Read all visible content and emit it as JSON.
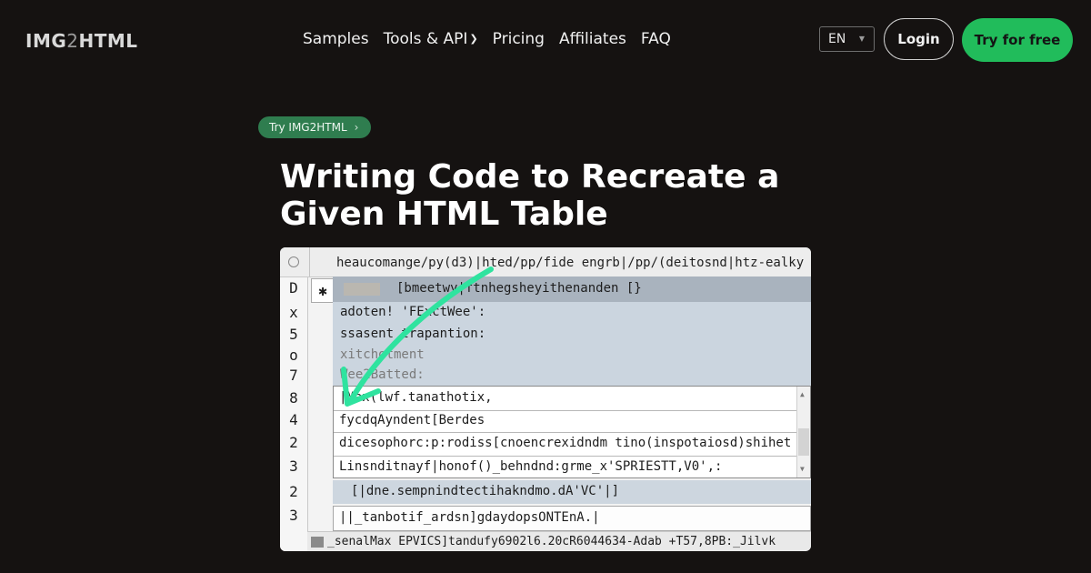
{
  "brand": {
    "logo_prefix": "IMG",
    "logo_mid": "2",
    "logo_suffix": "HTML"
  },
  "nav": {
    "items": [
      "Samples",
      "Tools & API",
      "Pricing",
      "Affiliates",
      "FAQ"
    ],
    "tools_caret": "chevron-down-icon"
  },
  "header": {
    "language": "EN",
    "login_label": "Login",
    "cta_label": "Try for free",
    "cta_color": "#21bc5b"
  },
  "hero": {
    "pill_label": "Try IMG2HTML",
    "title": "Writing Code to Recreate a Given HTML Table"
  },
  "screenshot": {
    "url_text": "heaucomange/py(d3)|hted/pp/fide engrb|/pp/(deitosnd|htz-ealky",
    "gutter": [
      "D",
      "x",
      "5",
      "o",
      "7",
      "8",
      "4",
      "2",
      "3",
      "2",
      "3"
    ],
    "header_row": "[bmeetwy|ftnhegsheyithenanden [}",
    "blue_lines": [
      "adoten! 'FExctWee':",
      "ssasent trapantion:",
      "xitchotment",
      "Wee2Batted:"
    ],
    "box_lines": [
      "|Max(lwf.tanathotix,",
      "fycdqAyndent[Berdes",
      "dicesophorc:p:rodiss[cnoencrexidndm tino(inspotaiosd)shihet",
      "Linsnditnayf|honof()_behndnd:grme_x'SPRIESTT,V0',:"
    ],
    "mid_text": "[|dne.sempnindtectihakndmo.dA'VC'|]",
    "bottom_text": "||_tanbotif_ardsn]gdaydopsONTEnA.|",
    "status_text": "_senalMax EPVICS]tandufy6902l6.20cR6044634-Adab +T57,8PB:_Jilvk"
  }
}
